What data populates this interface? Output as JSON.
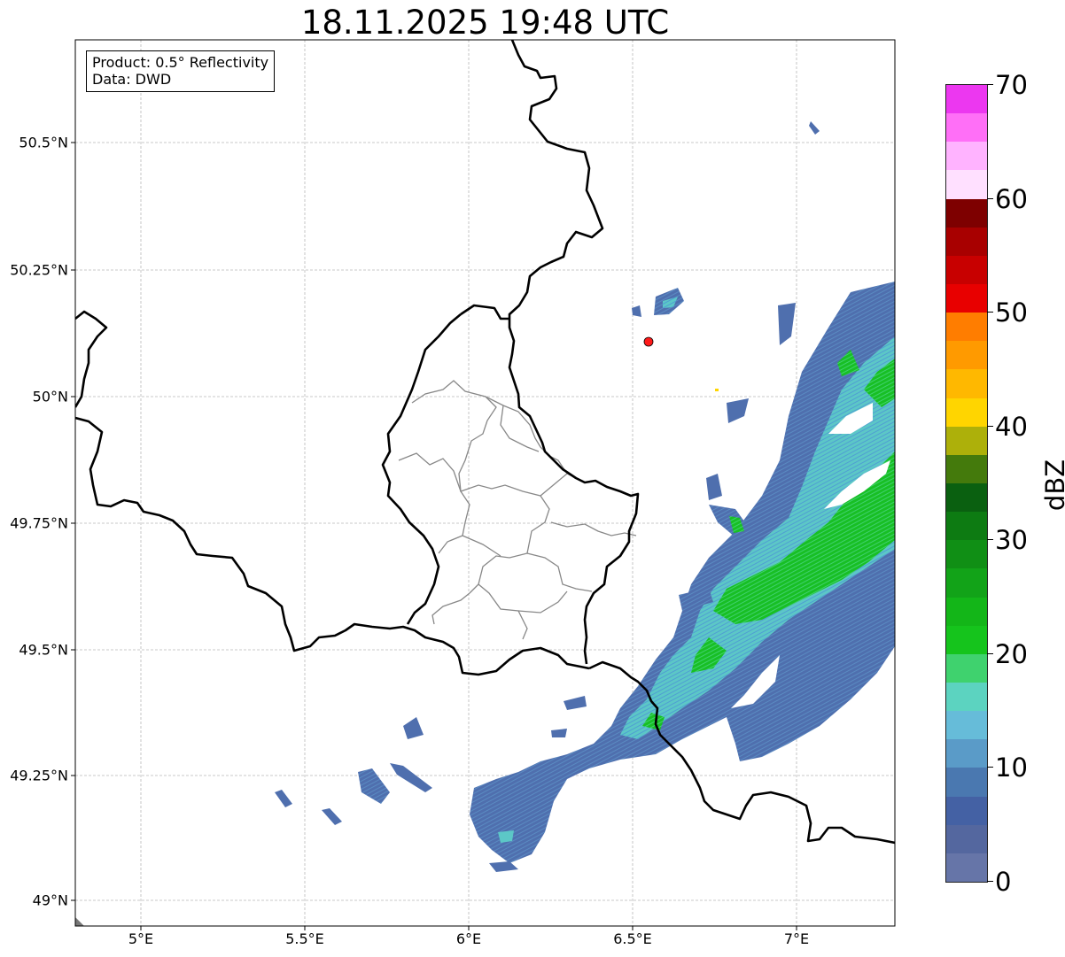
{
  "title": "18.11.2025 19:48 UTC",
  "info": {
    "product": "Product: 0.5° Reflectivity",
    "data": "Data: DWD"
  },
  "lat_labels": [
    "50.5°N",
    "50.25°N",
    "50°N",
    "49.75°N",
    "49.5°N",
    "49.25°N",
    "49°N"
  ],
  "lon_labels": [
    "5°E",
    "5.5°E",
    "6°E",
    "6.5°E",
    "7°E"
  ],
  "colorbar": {
    "label": "dBZ",
    "ticks": [
      "0",
      "10",
      "20",
      "30",
      "40",
      "50",
      "60",
      "70"
    ],
    "colors": [
      "#6675a8",
      "#54679f",
      "#4461a4",
      "#4a78b0",
      "#5a9bc8",
      "#66bcd9",
      "#5cd3c0",
      "#3fd26e",
      "#15c41c",
      "#13b618",
      "#12a318",
      "#108f15",
      "#0d7b12",
      "#0a6010",
      "#447a0c",
      "#adb00a",
      "#ffd500",
      "#ffb800",
      "#ff9a00",
      "#ff7d00",
      "#e80000",
      "#c80000",
      "#a80000",
      "#7e0000",
      "#ffe0ff",
      "#ffb3ff",
      "#ff6ff7",
      "#ec37f0"
    ]
  },
  "radar_site_color": "#ff1a1a"
}
